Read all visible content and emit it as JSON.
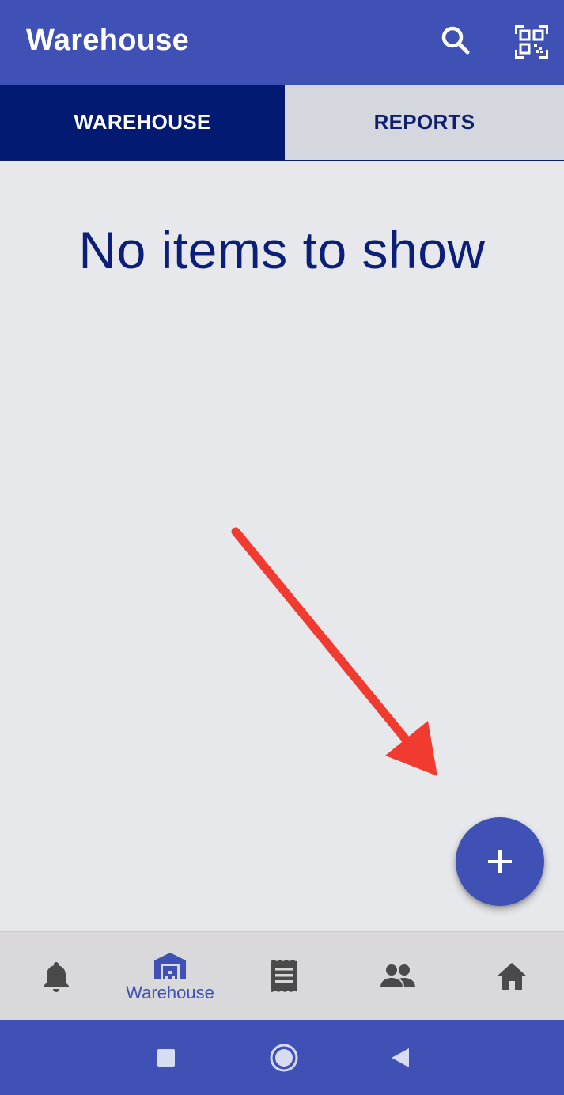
{
  "app_bar": {
    "title": "Warehouse",
    "icons": [
      "search-icon",
      "qr-code-scanner-icon"
    ],
    "background": "#3f51b5"
  },
  "tabs": [
    {
      "label": "WAREHOUSE",
      "active": true
    },
    {
      "label": "REPORTS",
      "active": false
    }
  ],
  "main": {
    "empty_message": "No items to show"
  },
  "fab": {
    "icon": "plus-icon"
  },
  "annotation": {
    "icon": "red-arrow-icon",
    "color": "#f23b30"
  },
  "bottom_nav": {
    "items": [
      {
        "icon": "bell-icon",
        "label": "",
        "active": false
      },
      {
        "icon": "warehouse-icon",
        "label": "Warehouse",
        "active": true
      },
      {
        "icon": "receipt-icon",
        "label": "",
        "active": false
      },
      {
        "icon": "people-icon",
        "label": "",
        "active": false
      },
      {
        "icon": "home-icon",
        "label": "",
        "active": false
      }
    ],
    "active_color": "#3f51b5",
    "inactive_color": "#4a4a4a"
  },
  "system_nav": {
    "icons": [
      "recents-square-icon",
      "home-circle-icon",
      "back-triangle-icon"
    ]
  }
}
